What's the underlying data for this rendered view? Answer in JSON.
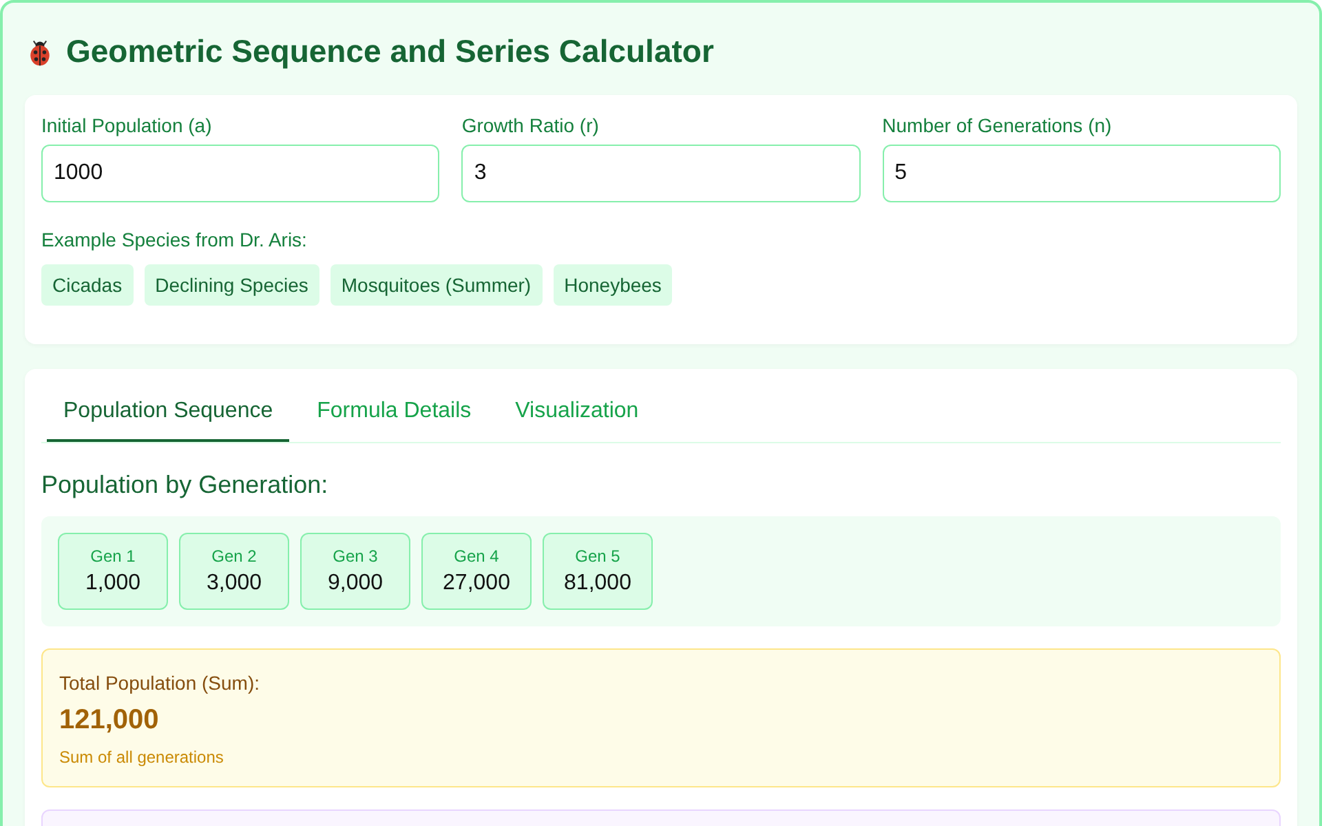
{
  "title": "Geometric Sequence and Series Calculator",
  "inputs": [
    {
      "label": "Initial Population (a)",
      "value": "1000"
    },
    {
      "label": "Growth Ratio (r)",
      "value": "3"
    },
    {
      "label": "Number of Generations (n)",
      "value": "5"
    }
  ],
  "examples": {
    "label": "Example Species from Dr. Aris:",
    "items": [
      "Cicadas",
      "Declining Species",
      "Mosquitoes (Summer)",
      "Honeybees"
    ]
  },
  "tabs": [
    {
      "label": "Population Sequence",
      "selected": true
    },
    {
      "label": "Formula Details",
      "selected": false
    },
    {
      "label": "Visualization",
      "selected": false
    }
  ],
  "sequence": {
    "heading": "Population by Generation:",
    "generations": [
      {
        "label": "Gen 1",
        "value": "1,000"
      },
      {
        "label": "Gen 2",
        "value": "3,000"
      },
      {
        "label": "Gen 3",
        "value": "9,000"
      },
      {
        "label": "Gen 4",
        "value": "27,000"
      },
      {
        "label": "Gen 5",
        "value": "81,000"
      }
    ]
  },
  "total": {
    "label": "Total Population (Sum):",
    "value": "121,000",
    "note": "Sum of all generations"
  }
}
